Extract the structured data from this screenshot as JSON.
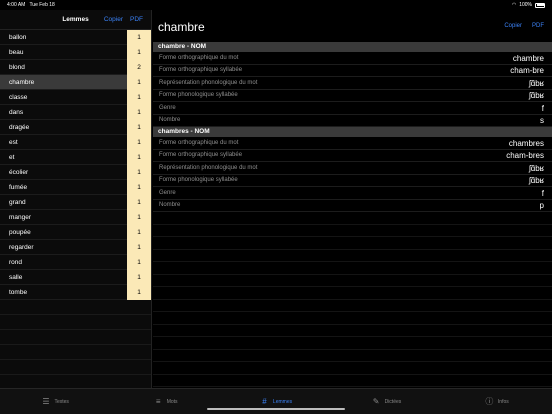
{
  "status": {
    "time": "4:00 AM",
    "date": "Tue Feb 18",
    "battery": "100%"
  },
  "left": {
    "title": "Lemmes",
    "copy_label": "Copier",
    "pdf_label": "PDF",
    "items": [
      {
        "label": "ballon",
        "count": "1"
      },
      {
        "label": "beau",
        "count": "1"
      },
      {
        "label": "blond",
        "count": "2"
      },
      {
        "label": "chambre",
        "count": "1",
        "selected": true
      },
      {
        "label": "classe",
        "count": "1"
      },
      {
        "label": "dans",
        "count": "1"
      },
      {
        "label": "dragée",
        "count": "1"
      },
      {
        "label": "est",
        "count": "1"
      },
      {
        "label": "et",
        "count": "1"
      },
      {
        "label": "écolier",
        "count": "1"
      },
      {
        "label": "fumée",
        "count": "1"
      },
      {
        "label": "grand",
        "count": "1"
      },
      {
        "label": "manger",
        "count": "1"
      },
      {
        "label": "poupée",
        "count": "1"
      },
      {
        "label": "regarder",
        "count": "1"
      },
      {
        "label": "rond",
        "count": "1"
      },
      {
        "label": "salle",
        "count": "1"
      },
      {
        "label": "tombe",
        "count": "1"
      }
    ]
  },
  "right": {
    "title": "chambre",
    "copy_label": "Copier",
    "pdf_label": "PDF",
    "sections": [
      {
        "header": "chambre - NOM",
        "rows": [
          {
            "label": "Forme orthographique du mot",
            "value": "chambre"
          },
          {
            "label": "Forme orthographique syllabée",
            "value": "cham-bre"
          },
          {
            "label": "Représentation phonologique du mot",
            "value": "ʃɑ̃bʁ"
          },
          {
            "label": "Forme phonologique syllabée",
            "value": "ʃɑ̃bʁ"
          },
          {
            "label": "Genre",
            "value": "f"
          },
          {
            "label": "Nombre",
            "value": "s"
          }
        ]
      },
      {
        "header": "chambres - NOM",
        "rows": [
          {
            "label": "Forme orthographique du mot",
            "value": "chambres"
          },
          {
            "label": "Forme orthographique syllabée",
            "value": "cham-bres"
          },
          {
            "label": "Représentation phonologique du mot",
            "value": "ʃɑ̃bʁ"
          },
          {
            "label": "Forme phonologique syllabée",
            "value": "ʃɑ̃bʁ"
          },
          {
            "label": "Genre",
            "value": "f"
          },
          {
            "label": "Nombre",
            "value": "p"
          }
        ]
      }
    ]
  },
  "tabs": [
    {
      "label": "Textes",
      "icon": "text-lines-icon",
      "active": false
    },
    {
      "label": "Mots",
      "icon": "list-icon",
      "active": false
    },
    {
      "label": "Lemmes",
      "icon": "hashtag-icon",
      "active": true
    },
    {
      "label": "Dictées",
      "icon": "dictation-icon",
      "active": false
    },
    {
      "label": "Infos",
      "icon": "info-icon",
      "active": false
    }
  ],
  "colors": {
    "accent": "#3b82f6",
    "count_bg": "#fbe9b7",
    "selected_row": "#3a3a3a",
    "section_header": "#3a3a3a"
  }
}
